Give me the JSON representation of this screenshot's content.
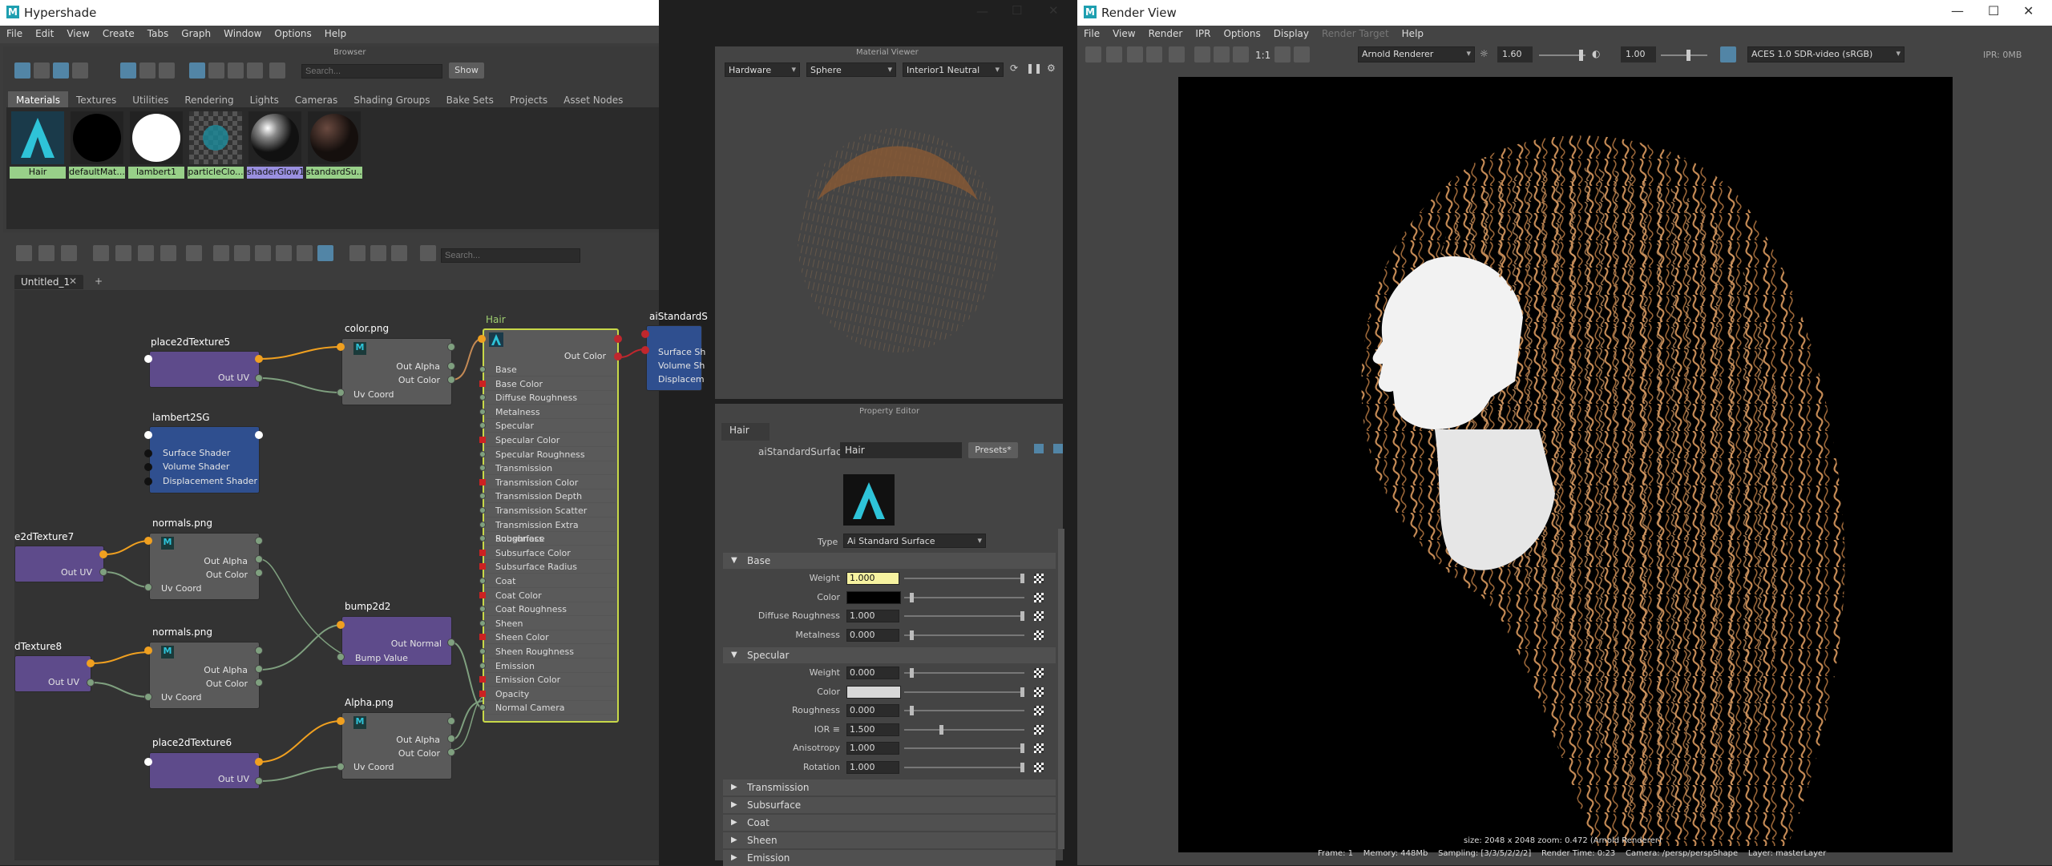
{
  "hypershade": {
    "title": "Hypershade",
    "menu": [
      "File",
      "Edit",
      "View",
      "Create",
      "Tabs",
      "Graph",
      "Window",
      "Options",
      "Help"
    ],
    "browser": {
      "header": "Browser",
      "search_placeholder": "Search...",
      "show_label": "Show",
      "tabs": [
        "Materials",
        "Textures",
        "Utilities",
        "Rendering",
        "Lights",
        "Cameras",
        "Shading Groups",
        "Bake Sets",
        "Projects",
        "Asset Nodes"
      ],
      "materials": [
        "Hair",
        "defaultMat...",
        "lambert1",
        "particleClo...",
        "shaderGlow1",
        "standardSu..."
      ]
    },
    "graph": {
      "search_placeholder": "Search...",
      "tab_name": "Untitled_1",
      "add_tab": "+",
      "nodes": {
        "place5": {
          "title": "place2dTexture5",
          "out": "Out UV"
        },
        "color": {
          "title": "color.png",
          "out1": "Out Alpha",
          "out2": "Out Color",
          "in": "Uv Coord"
        },
        "lambert": {
          "title": "lambert2SG",
          "p1": "Surface Shader",
          "p2": "Volume Shader",
          "p3": "Displacement Shader"
        },
        "place7": {
          "title": "e2dTexture7",
          "out": "Out UV"
        },
        "normals1": {
          "title": "normals.png",
          "out1": "Out Alpha",
          "out2": "Out Color",
          "in": "Uv Coord"
        },
        "bump": {
          "title": "bump2d2",
          "out": "Out Normal",
          "in": "Bump Value"
        },
        "place8": {
          "title": "dTexture8",
          "out": "Out UV"
        },
        "normals2": {
          "title": "normals.png",
          "out1": "Out Alpha",
          "out2": "Out Color",
          "in": "Uv Coord"
        },
        "alpha": {
          "title": "Alpha.png",
          "out1": "Out Alpha",
          "out2": "Out Color",
          "in": "Uv Coord"
        },
        "place6": {
          "title": "place2dTexture6",
          "out": "Out UV"
        },
        "hair": {
          "title": "Hair",
          "out": "Out Color",
          "attrs": [
            "Base",
            "Base Color",
            "Diffuse Roughness",
            "Metalness",
            "Specular",
            "Specular Color",
            "Specular Roughness",
            "Transmission",
            "Transmission Color",
            "Transmission Depth",
            "Transmission Scatter",
            "Transmission Extra Roughness",
            "Subsurface",
            "Subsurface Color",
            "Subsurface Radius",
            "Coat",
            "Coat Color",
            "Coat Roughness",
            "Sheen",
            "Sheen Color",
            "Sheen Roughness",
            "Emission",
            "Emission Color",
            "Opacity",
            "Normal Camera"
          ]
        },
        "aistd": {
          "title": "aiStandardS",
          "p1": "Surface Sh",
          "p2": "Volume Sh",
          "p3": "Displacem"
        }
      }
    },
    "material_viewer": {
      "header": "Material Viewer",
      "renderer": "Hardware",
      "geometry": "Sphere",
      "environment": "Interior1 Neutral"
    },
    "property_editor": {
      "header": "Property Editor",
      "tab": "Hair",
      "node_type_label": "aiStandardSurface:",
      "node_name": "Hair",
      "presets_label": "Presets*",
      "type_label": "Type",
      "type_value": "Ai Standard Surface",
      "sections_open": [
        {
          "name": "Base",
          "rows": [
            {
              "label": "Weight",
              "value": "1.000"
            },
            {
              "label": "Color",
              "value": ""
            },
            {
              "label": "Diffuse Roughness",
              "value": "1.000"
            },
            {
              "label": "Metalness",
              "value": "0.000"
            }
          ]
        },
        {
          "name": "Specular",
          "rows": [
            {
              "label": "Weight",
              "value": "0.000"
            },
            {
              "label": "Color",
              "value": ""
            },
            {
              "label": "Roughness",
              "value": "0.000"
            },
            {
              "label": "IOR ≡",
              "value": "1.500"
            },
            {
              "label": "Anisotropy",
              "value": "1.000"
            },
            {
              "label": "Rotation",
              "value": "1.000"
            }
          ]
        }
      ],
      "sections_closed": [
        "Transmission",
        "Subsurface",
        "Coat",
        "Sheen",
        "Emission"
      ]
    }
  },
  "render_view": {
    "title": "Render View",
    "menu": [
      "File",
      "View",
      "Render",
      "IPR",
      "Options",
      "Display",
      "Render Target",
      "Help"
    ],
    "renderer": "Arnold Renderer",
    "exposure": "1.60",
    "gamma": "1.00",
    "ratio": "1:1",
    "color_space": "ACES 1.0 SDR-video (sRGB)",
    "ipr_mem": "IPR: 0MB",
    "info_line": "size: 2048 x 2048  zoom: 0.472     (Arnold Renderer)",
    "status": {
      "frame": "Frame: 1",
      "memory": "Memory: 448Mb",
      "sampling": "Sampling: [3/3/5/2/2/2]",
      "render_time": "Render Time: 0:23",
      "camera": "Camera: /persp/perspShape",
      "layer": "Layer: masterLayer"
    }
  },
  "colors": {
    "accent": "#5285a6",
    "node_purple": "#5e4b8b",
    "node_blue": "#2f4f8f",
    "hair_border": "#c8d848",
    "hair_fill": "#c48a55"
  }
}
